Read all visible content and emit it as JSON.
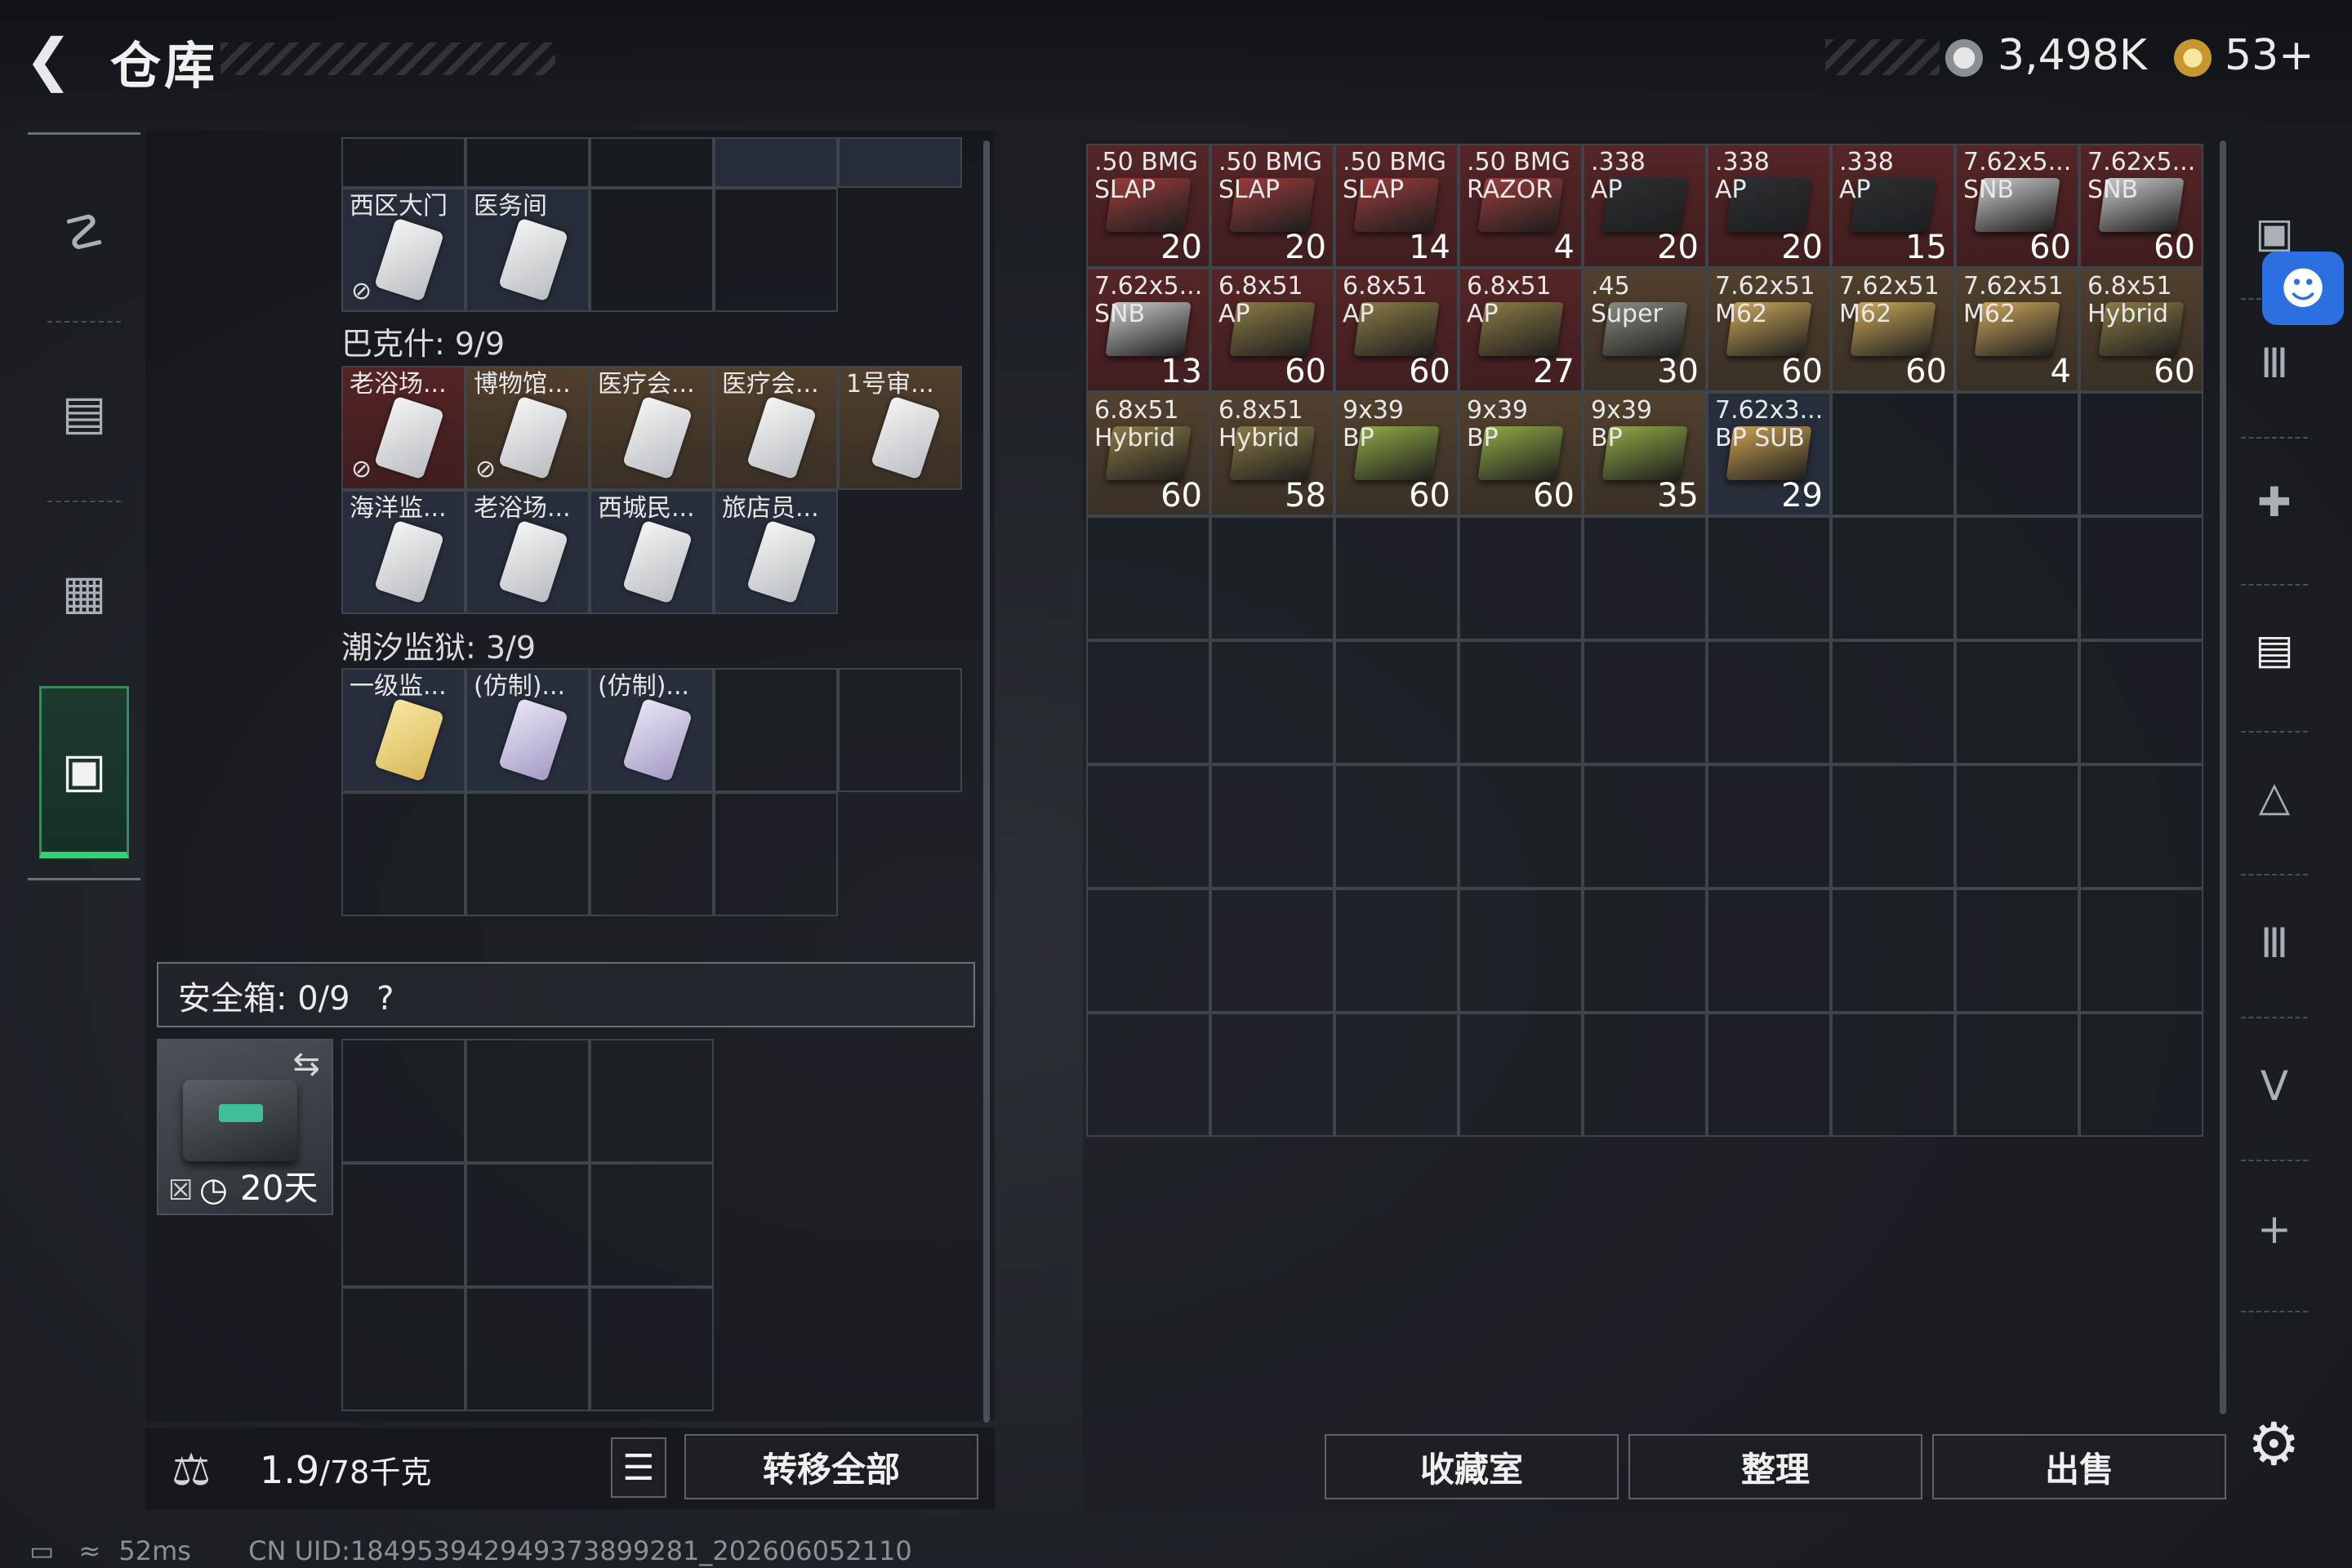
{
  "header": {
    "back_icon": "back-arrow-icon",
    "title": "仓库",
    "currency_1": {
      "icon": "silver-coin-icon",
      "value": "3,498K"
    },
    "currency_2": {
      "icon": "gold-coin-icon",
      "value": "53+"
    }
  },
  "left_rail": [
    {
      "name": "weapon",
      "icon": "gun-icon",
      "active": false
    },
    {
      "name": "backpack",
      "icon": "backpack-icon",
      "active": false
    },
    {
      "name": "vest",
      "icon": "vest-icon",
      "active": false
    },
    {
      "name": "case",
      "icon": "briefcase-icon",
      "active": true
    }
  ],
  "keycards": {
    "top_row": [
      {
        "label": "西区大门",
        "card": "white",
        "uncharged": true
      },
      {
        "label": "医务间",
        "card": "white",
        "uncharged": false
      }
    ],
    "bakeshi": {
      "title": "巴克什: 9/9",
      "items": [
        {
          "label": "老浴场...",
          "card": "white",
          "uncharged": true,
          "bg": "red"
        },
        {
          "label": "博物馆...",
          "card": "white",
          "uncharged": true,
          "bg": "brn"
        },
        {
          "label": "医疗会...",
          "card": "white",
          "uncharged": false,
          "bg": "brn"
        },
        {
          "label": "医疗会...",
          "card": "white",
          "uncharged": false,
          "bg": "brn"
        },
        {
          "label": "1号审...",
          "card": "white",
          "uncharged": false,
          "bg": "brn"
        },
        {
          "label": "海洋监...",
          "card": "white",
          "uncharged": false,
          "bg": "blu"
        },
        {
          "label": "老浴场...",
          "card": "white",
          "uncharged": false,
          "bg": "blu"
        },
        {
          "label": "西城民...",
          "card": "white",
          "uncharged": false,
          "bg": "blu"
        },
        {
          "label": "旅店员...",
          "card": "white",
          "uncharged": false,
          "bg": "blu"
        }
      ]
    },
    "prison": {
      "title": "潮汐监狱: 3/9",
      "items": [
        {
          "label": "一级监...",
          "card": "yellow"
        },
        {
          "label": "(仿制)...",
          "card": "purple"
        },
        {
          "label": "(仿制)...",
          "card": "purple"
        }
      ]
    }
  },
  "secure_box": {
    "label": "安全箱: 0/9",
    "help": "?",
    "swap_icon": "swap-icon",
    "lock_icon": "lock-icon",
    "clock_icon": "clock-icon",
    "timer": "20天"
  },
  "bottom_left": {
    "weight_icon": "kg-weight-icon",
    "weight_value": "1.9",
    "weight_max": "/78千克",
    "list_icon": "list-icon",
    "transfer_all": "转移全部"
  },
  "ammo": [
    {
      "label": ".50 BMG\nSLAP",
      "count": "20",
      "color": "red",
      "box": "#9a3b3b"
    },
    {
      "label": ".50 BMG\nSLAP",
      "count": "20",
      "color": "red",
      "box": "#9a3b3b"
    },
    {
      "label": ".50 BMG\nSLAP",
      "count": "14",
      "color": "red",
      "box": "#9a3b3b"
    },
    {
      "label": ".50 BMG\nRAZOR",
      "count": "4",
      "color": "red",
      "box": "#9a3b3b"
    },
    {
      "label": ".338\nAP",
      "count": "20",
      "color": "red",
      "box": "#2b2f33"
    },
    {
      "label": ".338\nAP",
      "count": "20",
      "color": "red",
      "box": "#2b2f33"
    },
    {
      "label": ".338\nAP",
      "count": "15",
      "color": "red",
      "box": "#2b2f33"
    },
    {
      "label": "7.62x5...\nSNB",
      "count": "60",
      "color": "red",
      "box": "#c9c9c9"
    },
    {
      "label": "7.62x5...\nSNB",
      "count": "60",
      "color": "red",
      "box": "#c9c9c9"
    },
    {
      "label": "7.62x5...\nSNB",
      "count": "13",
      "color": "red",
      "box": "#c9c9c9"
    },
    {
      "label": "6.8x51\nAP",
      "count": "60",
      "color": "red",
      "box": "#8a7a45"
    },
    {
      "label": "6.8x51\nAP",
      "count": "60",
      "color": "red",
      "box": "#8a7a45"
    },
    {
      "label": "6.8x51\nAP",
      "count": "27",
      "color": "red",
      "box": "#8a7a45"
    },
    {
      "label": ".45\nSuper",
      "count": "30",
      "color": "brn",
      "box": "#8a8a80"
    },
    {
      "label": "7.62x51\nM62",
      "count": "60",
      "color": "brn",
      "box": "#c9a55a"
    },
    {
      "label": "7.62x51\nM62",
      "count": "60",
      "color": "brn",
      "box": "#c9a55a"
    },
    {
      "label": "7.62x51\nM62",
      "count": "4",
      "color": "brn",
      "box": "#c9a55a"
    },
    {
      "label": "6.8x51\nHybrid",
      "count": "60",
      "color": "brn",
      "box": "#8a7a45"
    },
    {
      "label": "6.8x51\nHybrid",
      "count": "60",
      "color": "brn",
      "box": "#8a7a45"
    },
    {
      "label": "6.8x51\nHybrid",
      "count": "58",
      "color": "brn",
      "box": "#8a7a45"
    },
    {
      "label": "9x39\nBP",
      "count": "60",
      "color": "brn",
      "box": "#8fa845"
    },
    {
      "label": "9x39\nBP",
      "count": "60",
      "color": "brn",
      "box": "#8fa845"
    },
    {
      "label": "9x39\nBP",
      "count": "35",
      "color": "brn",
      "box": "#8fa845"
    },
    {
      "label": "7.62x3...\nBP SUB",
      "count": "29",
      "color": "blu",
      "box": "#c9a050"
    }
  ],
  "right_side": [
    {
      "icon": "safe-icon"
    },
    {
      "icon": "tier3-armor-icon"
    },
    {
      "icon": "tier4-medical-icon"
    },
    {
      "icon": "tier4-folder-icon"
    },
    {
      "icon": "tier4-keycard-icon"
    },
    {
      "icon": "tier3-armor-icon"
    },
    {
      "icon": "tier5-gear-icon"
    },
    {
      "icon": "plus-icon"
    }
  ],
  "accessibility_icon": "accessibility-icon",
  "settings_icon": "gear-icon",
  "bottom_right": {
    "collection": "收藏室",
    "sort": "整理",
    "sell": "出售"
  },
  "status": {
    "ping": "52ms",
    "uid": "CN UID:1849539429493738992​81_202606052110"
  }
}
